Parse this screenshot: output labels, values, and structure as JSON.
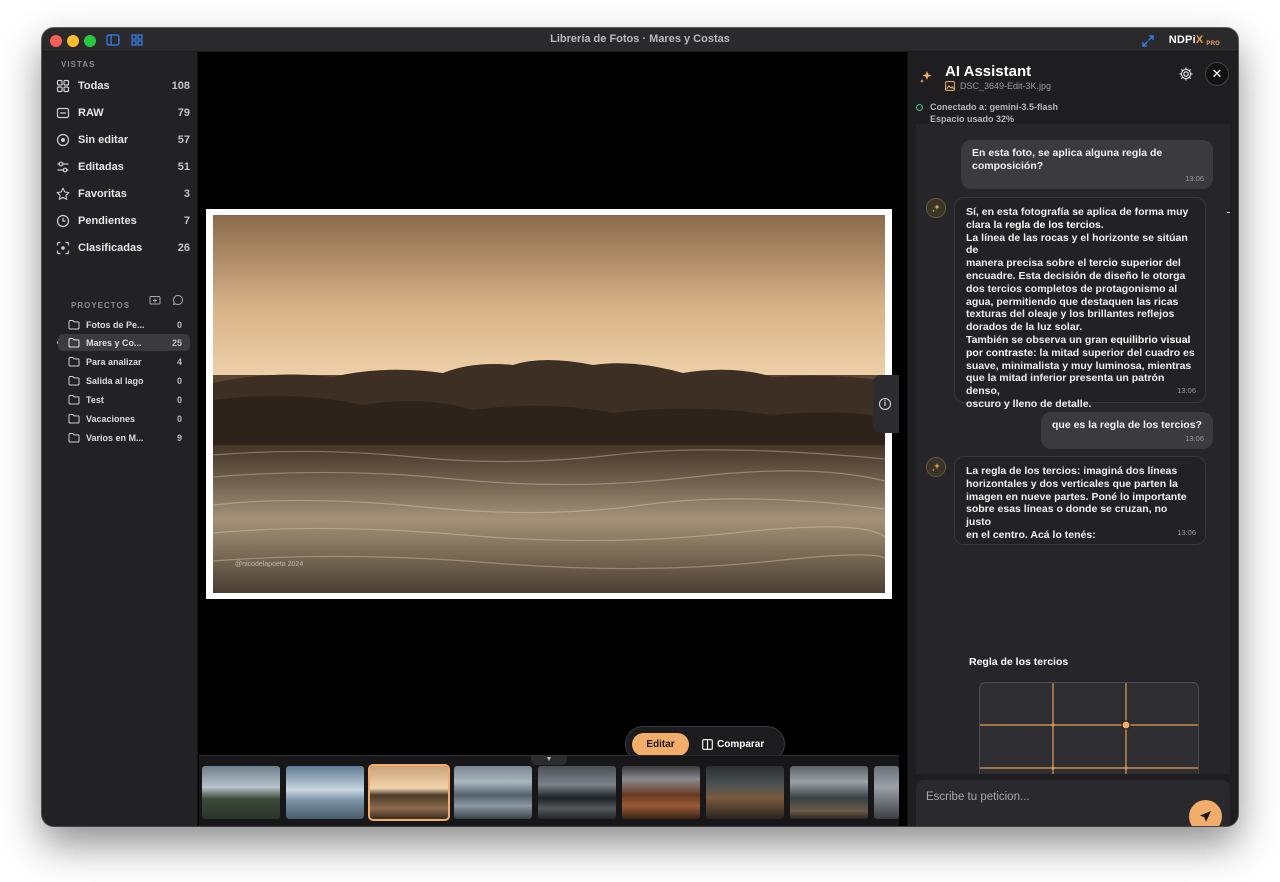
{
  "window": {
    "title": "Librería de Fotos · Mares y Costas",
    "brand_main": "NDPi",
    "brand_x": "X",
    "brand_tier": "PRO"
  },
  "sidebar": {
    "views_heading": "VISTAS",
    "views": [
      {
        "label": "Todas",
        "count": "108"
      },
      {
        "label": "RAW",
        "count": "79"
      },
      {
        "label": "Sin editar",
        "count": "57"
      },
      {
        "label": "Editadas",
        "count": "51"
      },
      {
        "label": "Favoritas",
        "count": "3"
      },
      {
        "label": "Pendientes",
        "count": "7"
      },
      {
        "label": "Clasificadas",
        "count": "26"
      }
    ],
    "projects_heading": "PROYECTOS",
    "projects": [
      {
        "label": "Fotos de Pe...",
        "count": "0"
      },
      {
        "label": "Mares y Co...",
        "count": "25"
      },
      {
        "label": "Para analizar",
        "count": "4"
      },
      {
        "label": "Salida al lago",
        "count": "0"
      },
      {
        "label": "Test",
        "count": "0"
      },
      {
        "label": "Vacaciones",
        "count": "0"
      },
      {
        "label": "Varios en M...",
        "count": "9"
      }
    ]
  },
  "viewer": {
    "credit": "@nicodelapoeta 2024",
    "edit_label": "Editar",
    "compare_label": "Comparar"
  },
  "assistant": {
    "title": "AI Assistant",
    "file": "DSC_3649-Edit-3K.jpg",
    "status_line1": "Conectado a: gemini-3.5-flash",
    "status_line2": "Espacio usado 32%",
    "msg1": {
      "l1": "En esta foto, se aplica alguna regla de",
      "l2": "composición?",
      "time": "13:06"
    },
    "msg2": {
      "p1a": "Sí, en esta fotografía se aplica de forma muy",
      "p1b": "clara la ",
      "p1c": "regla de los tercios.",
      "p2a": "La línea de las rocas y el horizonte se sitúan de",
      "p2b": "manera precisa sobre el ",
      "p2c": "tercio superior",
      "p2d": " del",
      "p2e": "encuadre. Esta decisión de diseño le otorga",
      "p2f": "dos tercios completos de protagonismo al",
      "p2g": "agua, permitiendo que destaquen las ricas",
      "p2h": "texturas del oleaje y los brillantes reflejos",
      "p2i": "dorados de la luz solar.",
      "p3a": "También se observa un gran ",
      "p3b": "equilibrio visual",
      "p3c": "por contraste",
      "p3d": ": la mitad superior del cuadro es",
      "p3e": "suave, minimalista y muy luminosa, mientras",
      "p3f": "que la mitad inferior presenta un patrón denso,",
      "p3g": "oscuro y lleno de detalle.",
      "time": "13:06"
    },
    "msg3": {
      "text": "que es la regla de los tercios?",
      "time": "13:06"
    },
    "msg4": {
      "l1": "La regla de los tercios: imaginá dos líneas",
      "l2": "horizontales y dos verticales que parten la",
      "l3": "imagen en nueve partes. Poné lo importante",
      "l4": "sobre esas líneas o donde se cruzan, no justo",
      "l5": "en el centro. Acá lo tenés:",
      "time": "13:06"
    },
    "grid_title": "Regla de los tercios",
    "input_placeholder": "Escribe tu peticion...",
    "accent": "#f2ad6b"
  }
}
